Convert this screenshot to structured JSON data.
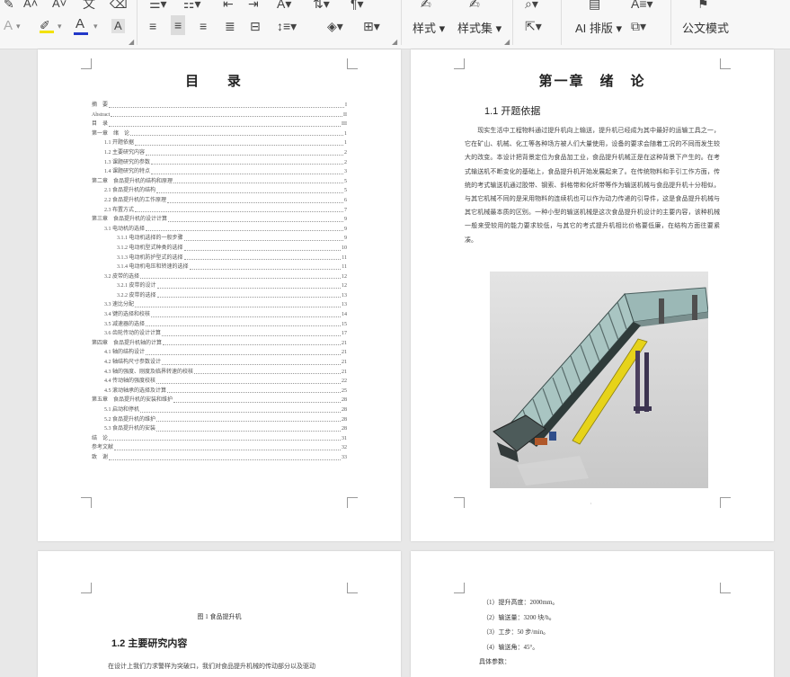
{
  "ribbon": {
    "style_label": "样式",
    "style_set_label": "样式集",
    "ai_layout_label": "AI 排版",
    "doc_mode_label": "公文模式",
    "format_char": "A"
  },
  "page1": {
    "toc_title": "目 录",
    "entries": [
      {
        "t": "摘　要",
        "p": "I"
      },
      {
        "t": "Abstract",
        "p": "II"
      },
      {
        "t": "目　录",
        "p": "III"
      },
      {
        "t": "第一章　绪　论",
        "p": "1"
      },
      {
        "t": "1.1 开题依据",
        "p": "1"
      },
      {
        "t": "1.2 主要研究内容",
        "p": "2"
      },
      {
        "t": "1.3 课题研究的参数",
        "p": "2"
      },
      {
        "t": "1.4 课题研究的特点",
        "p": "3"
      },
      {
        "t": "第二章　食品提升机的结构和原理",
        "p": "5"
      },
      {
        "t": "2.1 食品提升机的结构",
        "p": "5"
      },
      {
        "t": "2.2 食品提升机的工作原理",
        "p": "6"
      },
      {
        "t": "2.3 布置方式",
        "p": "7"
      },
      {
        "t": "第三章　食品提升机的设计计算",
        "p": "9"
      },
      {
        "t": "3.1 电动机的选择",
        "p": "9"
      },
      {
        "t": "3.1.1 电动机选择的一般步骤",
        "p": "9"
      },
      {
        "t": "3.1.2 电动机型式种类的选择",
        "p": "10"
      },
      {
        "t": "3.1.3 电动机防护型式的选择",
        "p": "11"
      },
      {
        "t": "3.1.4 电动机电压和转速的选择",
        "p": "11"
      },
      {
        "t": "3.2 皮带的选择",
        "p": "12"
      },
      {
        "t": "3.2.1 皮带的设计",
        "p": "12"
      },
      {
        "t": "3.2.2 皮带的选择",
        "p": "13"
      },
      {
        "t": "3.3 速比分配",
        "p": "13"
      },
      {
        "t": "3.4 键的选择和校核",
        "p": "14"
      },
      {
        "t": "3.5 减速器的选择",
        "p": "15"
      },
      {
        "t": "3.6 齿轮传动的设计计算",
        "p": "17"
      },
      {
        "t": "第四章　食品提升机轴的计算",
        "p": "21"
      },
      {
        "t": "4.1 轴的结构设计",
        "p": "21"
      },
      {
        "t": "4.2 轴结构尺寸参数设计",
        "p": "21"
      },
      {
        "t": "4.3 轴的强度、刚度及临界转速的校核",
        "p": "21"
      },
      {
        "t": "4.4 传动轴的强度校核",
        "p": "22"
      },
      {
        "t": "4.5 滚动轴承的选择及计算",
        "p": "25"
      },
      {
        "t": "第五章　食品提升机的安装和维护",
        "p": "28"
      },
      {
        "t": "5.1 启动和停机",
        "p": "28"
      },
      {
        "t": "5.2 食品提升机的维护",
        "p": "28"
      },
      {
        "t": "5.3 食品提升机的安装",
        "p": "28"
      },
      {
        "t": "结　论",
        "p": "31"
      },
      {
        "t": "参考文献",
        "p": "32"
      },
      {
        "t": "致　谢",
        "p": "33"
      }
    ]
  },
  "page2": {
    "chapter_title": "第一章　绪　论",
    "section_title": "1.1 开题依据",
    "paragraph": "　　现实生活中工程物料通过提升机向上输送，提升机已经成为其中最好的运输工具之一，它在矿山、机械、化工等各种场方被人们大量使用，设备的要求会随着工况的不同而发生较大的改变。本设计把背景定位为食品加工业，食品提升机械正是在这种背景下产生的。在考式输送机不断变化的基础上，食品提升机开始发展起来了。在传统物料和手引工作方面，传统的考式输送机通过胶带、钢索、斜格带和化纤带等作为输送机械与食品提升机十分相似，与其它机械不同的是采用物料的连续机也可以作为动力传递的引导件，这是食品提升机械与其它机械最本质的区别。一种小型的输送机械是这次食品提升机设计的主要内容，该种机械一般来受较用的能力要求较低，与其它的考式提升机相比价格要低廉，在结构方面往要紧凑。"
  },
  "page3": {
    "figure_caption": "图 1 食品提升机",
    "section_title": "1.2 主要研究内容",
    "paragraph_start": "在设计上我们力求警样为突破口，我们对食品提升机械的传动部分以及驱动"
  },
  "page4": {
    "params": [
      "（1）提升高度：2000mm。",
      "（2）输送量：3200 块/h。",
      "（3）工步：50 步/min。",
      "（4）输送角：45°。",
      "具体参数："
    ]
  }
}
